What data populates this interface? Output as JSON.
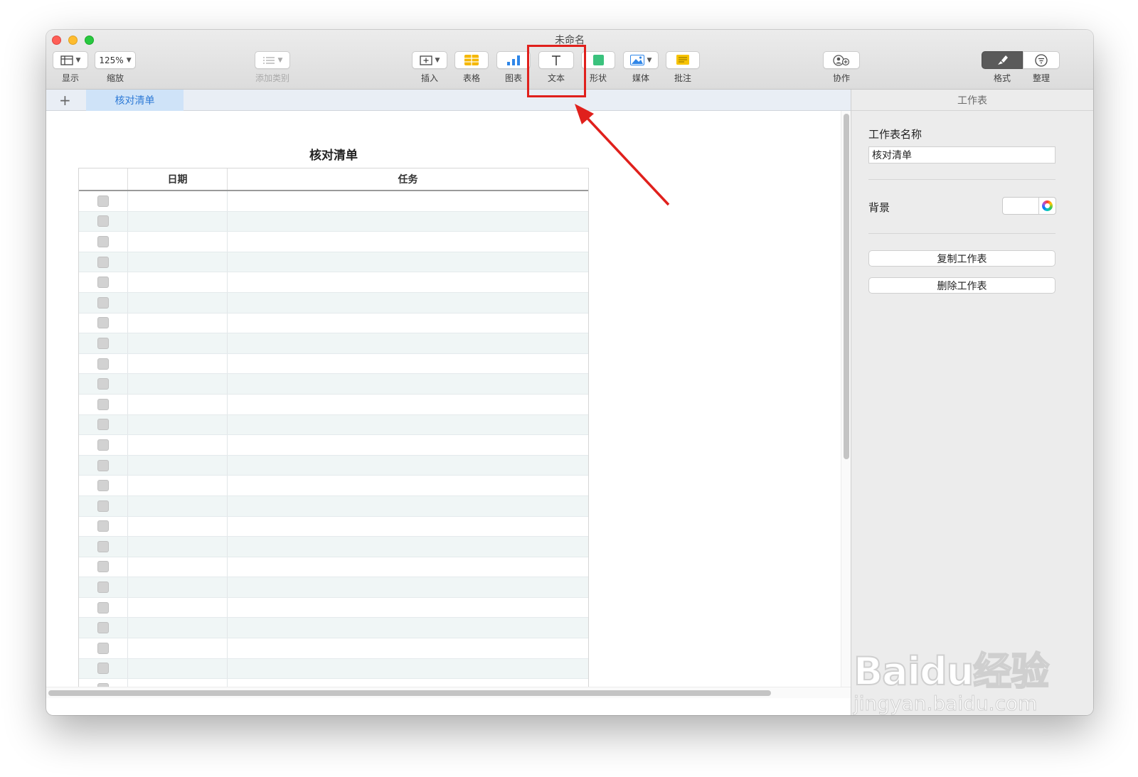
{
  "window": {
    "title": "未命名"
  },
  "toolbar": {
    "view_label": "显示",
    "zoom_value": "125%",
    "zoom_label": "缩放",
    "add_category_label": "添加类别",
    "insert_label": "插入",
    "table_label": "表格",
    "chart_label": "图表",
    "text_label": "文本",
    "shape_label": "形状",
    "media_label": "媒体",
    "comment_label": "批注",
    "collaborate_label": "协作",
    "format_label": "格式",
    "organize_label": "整理"
  },
  "tabs": {
    "add": "+",
    "active": "核对清单"
  },
  "sheet": {
    "title": "核对清单",
    "columns": [
      "",
      "日期",
      "任务"
    ],
    "row_count": 25
  },
  "inspector": {
    "header": "工作表",
    "name_label": "工作表名称",
    "name_value": "核对清单",
    "background_label": "背景",
    "duplicate_button": "复制工作表",
    "delete_button": "删除工作表"
  },
  "colors": {
    "accent": "#2d7ad6",
    "highlight": "#e0201c",
    "row_stripe": "#f0f6f6"
  },
  "watermark": {
    "logo": "Baidu经验",
    "url": "jingyan.baidu.com"
  }
}
